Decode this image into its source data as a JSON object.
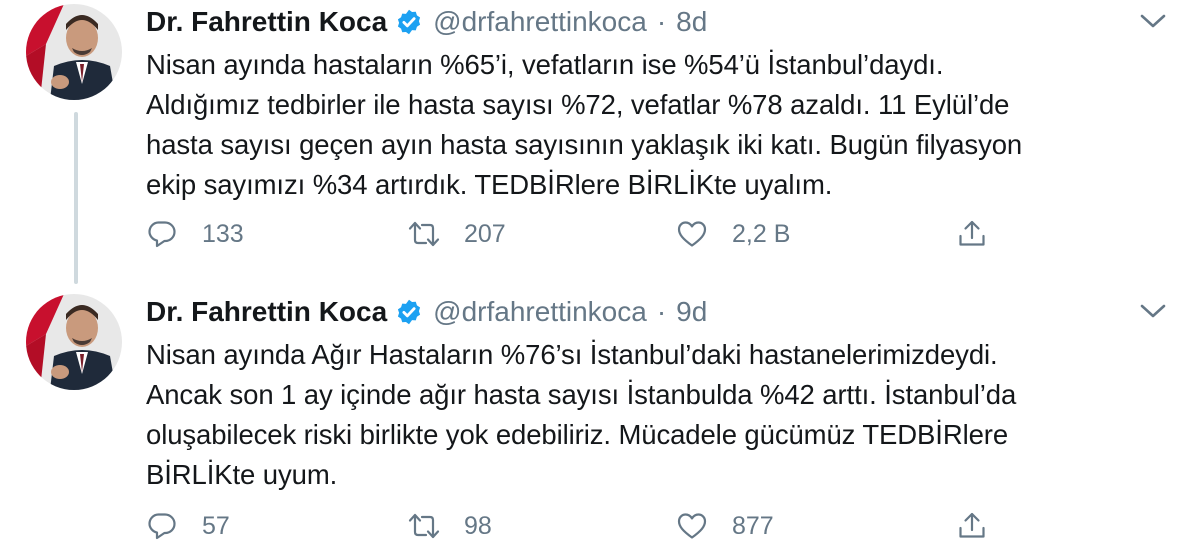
{
  "tweets": [
    {
      "author_name": "Dr. Fahrettin Koca",
      "handle": "@drfahrettinkoca",
      "separator": "·",
      "time": "8d",
      "lines": [
        "Nisan ayında hastaların %65’i, vefatların ise %54’ü İstanbul’daydı.",
        "Aldığımız tedbirler ile hasta sayısı %72, vefatlar %78 azaldı. 11 Eylül’de",
        "hasta sayısı geçen ayın hasta sayısının yaklaşık iki katı. Bugün filyasyon",
        "ekip sayımızı %34 artırdık. TEDBİRlere BİRLİKte uyalım."
      ],
      "replies": "133",
      "retweets": "207",
      "likes": "2,2 B"
    },
    {
      "author_name": "Dr. Fahrettin Koca",
      "handle": "@drfahrettinkoca",
      "separator": "·",
      "time": "9d",
      "lines": [
        "Nisan ayında Ağır Hastaların %76’sı İstanbul’daki hastanelerimizdeydi.",
        "Ancak son 1 ay içinde ağır hasta sayısı İstanbulda %42 arttı. İstanbul’da",
        "oluşabilecek riski birlikte yok edebiliriz. Mücadele gücümüz TEDBİRlere",
        "BİRLİKte uyum."
      ],
      "replies": "57",
      "retweets": "98",
      "likes": "877"
    }
  ],
  "icons": {
    "reply": "reply-icon",
    "retweet": "retweet-icon",
    "like": "heart-icon",
    "share": "share-icon",
    "verified": "verified-badge-icon",
    "caret": "chevron-down-icon"
  },
  "colors": {
    "text": "#14171a",
    "secondary": "#657786",
    "verified": "#1da1f2",
    "thread_line": "#cfd9de"
  }
}
